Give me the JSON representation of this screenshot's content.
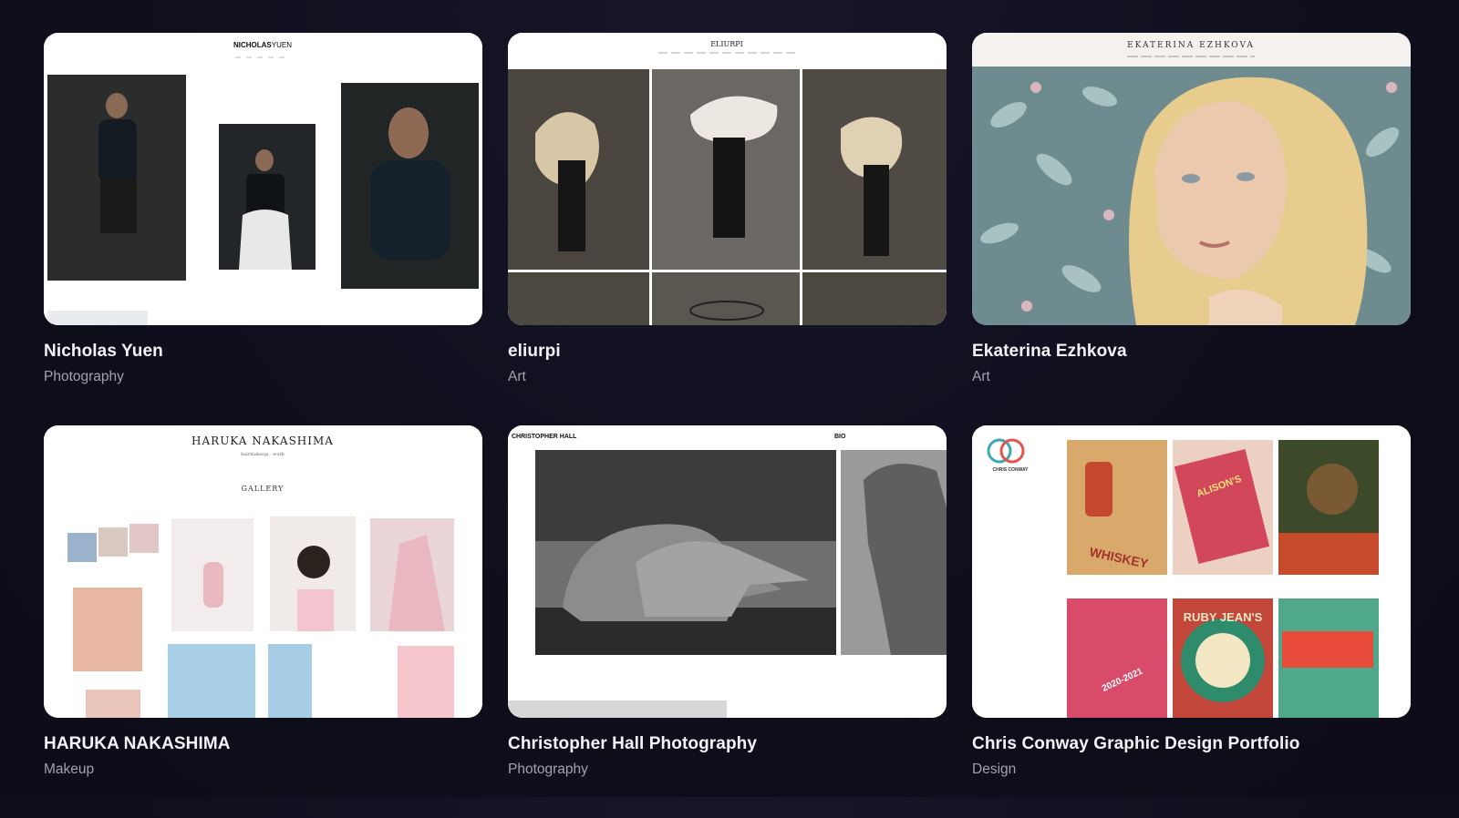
{
  "cards": [
    {
      "title": "Nicholas Yuen",
      "category": "Photography",
      "site_name_a": "NICHOLAS",
      "site_name_b": "YUEN"
    },
    {
      "title": "eliurpi",
      "category": "Art",
      "site_name": "ELIURPI"
    },
    {
      "title": "Ekaterina Ezhkova",
      "category": "Art",
      "site_name": "EKATERINA EZHKOVA"
    },
    {
      "title": "HARUKA NAKASHIMA",
      "category": "Makeup",
      "site_name": "HARUKA NAKASHIMA",
      "site_sub": "hairmakeup · work",
      "gallery": "GALLERY"
    },
    {
      "title": "Christopher Hall Photography",
      "category": "Photography",
      "site_name": "CHRISTOPHER HALL",
      "site_menu": "BIO"
    },
    {
      "title": "Chris Conway Graphic Design Portfolio",
      "category": "Design",
      "site_name": "CHRIS CONWAY",
      "tile_a": "WHISKEY",
      "tile_b": "ALISON'S",
      "tile_c": "2020-2021",
      "tile_d": "RUBY JEAN'S"
    }
  ]
}
